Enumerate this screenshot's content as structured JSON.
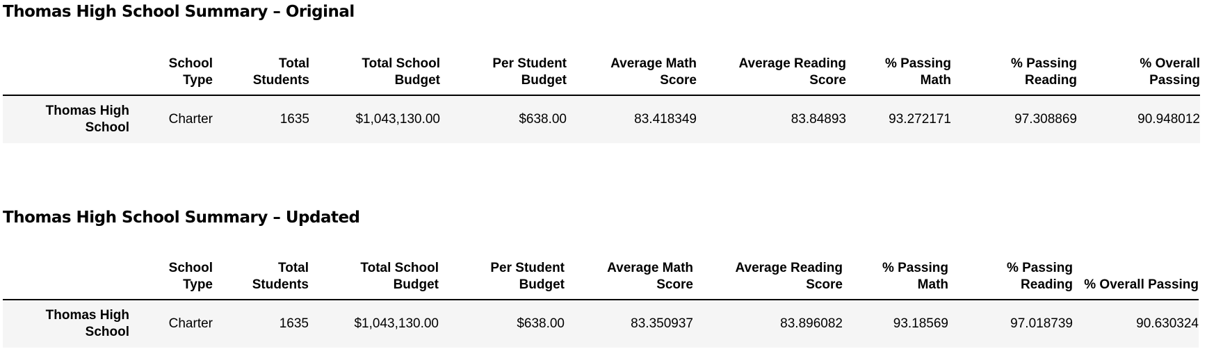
{
  "tables": [
    {
      "title": "Thomas High School Summary – Original",
      "columns": [
        "School Type",
        "Total Students",
        "Total School Budget",
        "Per Student Budget",
        "Average Math Score",
        "Average Reading Score",
        "% Passing Math",
        "% Passing Reading",
        "% Overall Passing"
      ],
      "row": {
        "index": "Thomas High School",
        "values": [
          "Charter",
          "1635",
          "$1,043,130.00",
          "$638.00",
          "83.418349",
          "83.84893",
          "93.272171",
          "97.308869",
          "90.948012"
        ]
      }
    },
    {
      "title": "Thomas High School Summary – Updated",
      "columns": [
        "School Type",
        "Total Students",
        "Total School Budget",
        "Per Student Budget",
        "Average Math Score",
        "Average Reading Score",
        "% Passing Math",
        "% Passing Reading",
        "% Overall Passing"
      ],
      "row": {
        "index": "Thomas High School",
        "values": [
          "Charter",
          "1635",
          "$1,043,130.00",
          "$638.00",
          "83.350937",
          "83.896082",
          "93.18569",
          "97.018739",
          "90.630324"
        ]
      }
    }
  ]
}
